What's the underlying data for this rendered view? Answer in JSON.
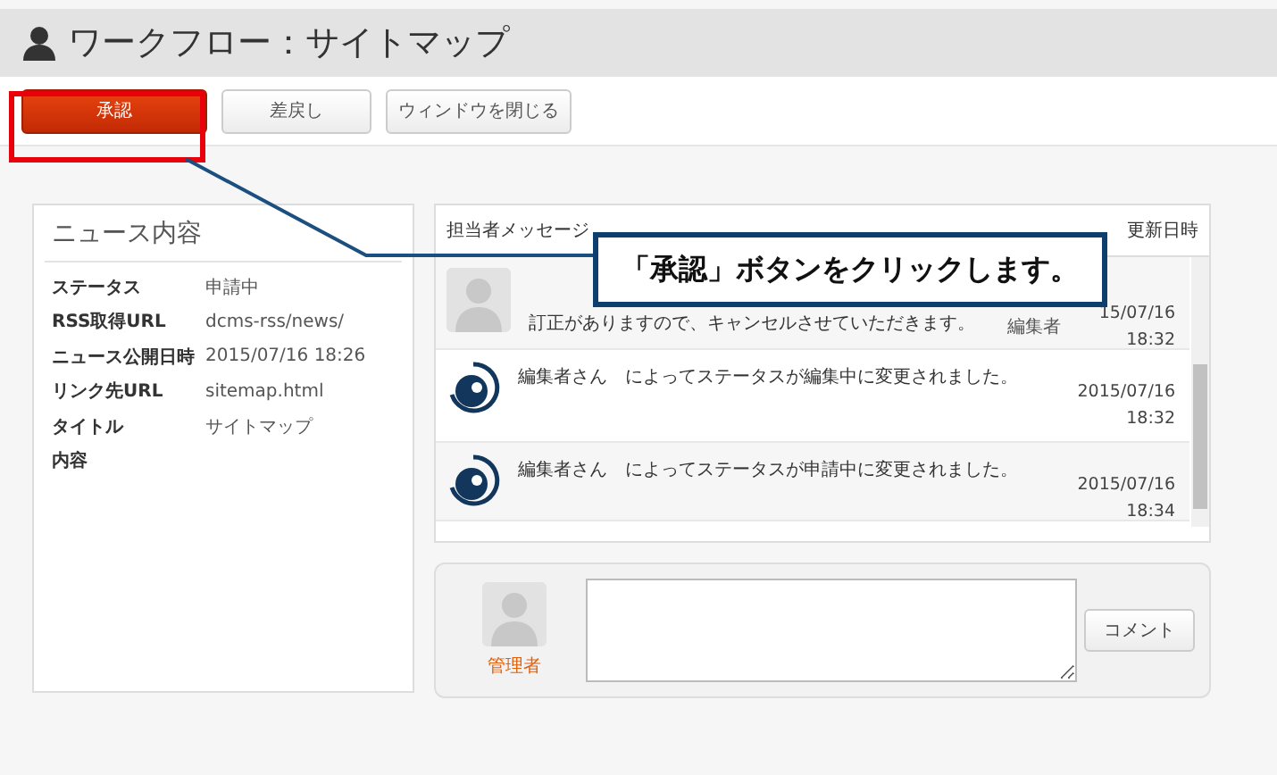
{
  "window": {
    "title": "ワークフロー：サイトマップ"
  },
  "toolbar": [
    {
      "label": "承認",
      "kind": "primary"
    },
    {
      "label": "差戻し",
      "kind": "plain"
    },
    {
      "label": "ウィンドウを閉じる",
      "kind": "plain"
    }
  ],
  "news": {
    "heading": "ニュース内容",
    "fields": [
      {
        "label": "ステータス",
        "value": "申請中"
      },
      {
        "label": "RSS取得URL",
        "value": "dcms-rss/news/"
      },
      {
        "label": "ニュース公開日時",
        "value": "2015/07/16 18:26"
      },
      {
        "label": "リンク先URL",
        "value": "sitemap.html"
      },
      {
        "label": "タイトル",
        "value": "サイトマップ"
      },
      {
        "label": "内容"
      }
    ]
  },
  "messages": {
    "columns": [
      "担当者メッセージ",
      "更新日時"
    ],
    "rows": [
      {
        "kind": "person",
        "text": "訂正がありますので、キャンセルさせていただきます。",
        "role": "編集者",
        "date": "15/07/16",
        "time": "18:32"
      },
      {
        "kind": "logo",
        "text": "編集者さん　によってステータスが編集中に変更されました。",
        "date": "2015/07/16",
        "time": "18:32"
      },
      {
        "kind": "logo",
        "text": "編集者さん　によってステータスが申請中に変更されました。",
        "date": "2015/07/16",
        "time": "18:34"
      }
    ]
  },
  "comment": {
    "user": "管理者",
    "button": "コメント"
  },
  "callout": {
    "text": "「承認」ボタンをクリックします。"
  }
}
